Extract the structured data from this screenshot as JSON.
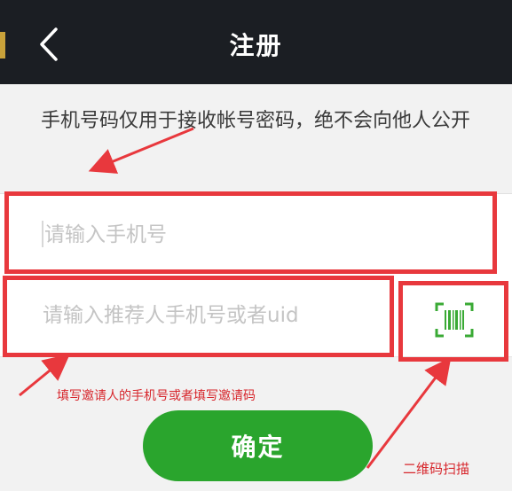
{
  "header": {
    "title": "注册"
  },
  "notice": "手机号码仅用于接收帐号密码，绝不会向他人公开",
  "form": {
    "phone_placeholder": "请输入手机号",
    "referrer_placeholder": "请输入推荐人手机号或者uid"
  },
  "confirm_label": "确定",
  "annotations": {
    "referrer_hint": "填写邀请人的手机号或者填写邀请码",
    "scan_hint": "二维码扫描"
  },
  "colors": {
    "header_bg": "#1b1e23",
    "accent_green": "#2aa52d",
    "annotation_red": "#e8383d"
  },
  "icons": {
    "back": "chevron-left-icon",
    "scan": "barcode-scan-icon"
  }
}
